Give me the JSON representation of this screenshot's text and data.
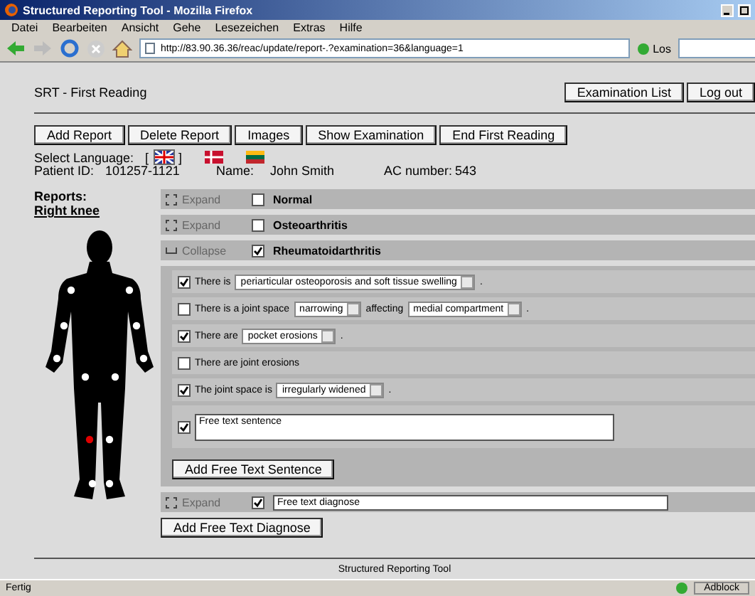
{
  "window": {
    "title": "Structured Reporting Tool - Mozilla Firefox",
    "menu": [
      "Datei",
      "Bearbeiten",
      "Ansicht",
      "Gehe",
      "Lesezeichen",
      "Extras",
      "Hilfe"
    ],
    "url": "http://83.90.36.36/reac/update/report-.?examination=36&language=1",
    "go_button": "Los"
  },
  "page": {
    "heading": "SRT - First Reading",
    "header_buttons": [
      "Examination List",
      "Log out"
    ],
    "actions": [
      "Add Report",
      "Delete Report",
      "Images",
      "Show Examination",
      "End First Reading"
    ],
    "language": {
      "label": "Select Language:",
      "open_mark": "[",
      "close_mark": "]",
      "flags": [
        {
          "kind": "uk",
          "selected": true
        },
        {
          "kind": "dk",
          "selected": false
        },
        {
          "kind": "lt",
          "selected": false
        }
      ]
    },
    "patient": [
      {
        "label": "Patient ID:",
        "value": "101257-1121"
      },
      {
        "label": "Name:",
        "value": "John Smith"
      },
      {
        "label": "AC number:",
        "value": "543"
      }
    ],
    "reports": {
      "label": "Reports:",
      "items": [
        "Right knee"
      ],
      "joints": [
        {
          "selected": false
        },
        {
          "selected": false
        },
        {
          "selected": false
        },
        {
          "selected": false
        },
        {
          "selected": false
        },
        {
          "selected": false
        },
        {
          "selected": false
        },
        {
          "selected": false
        },
        {
          "selected": true
        },
        {
          "selected": false
        },
        {
          "selected": false
        },
        {
          "selected": false
        }
      ]
    },
    "diagnoses": [
      {
        "toggle": "Expand",
        "expanded": false,
        "checked": false,
        "kind": "label",
        "label": "Normal"
      },
      {
        "toggle": "Expand",
        "expanded": false,
        "checked": false,
        "kind": "label",
        "label": "Osteoarthritis"
      },
      {
        "toggle": "Collapse",
        "expanded": true,
        "checked": true,
        "kind": "label",
        "label": "Rheumatoidarthritis",
        "sentences": [
          {
            "checked": true,
            "parts": [
              {
                "kind": "text",
                "text": "There is"
              },
              {
                "kind": "select",
                "value": "periarticular osteoporosis and soft tissue swelling"
              },
              {
                "kind": "text",
                "text": "."
              }
            ]
          },
          {
            "checked": false,
            "parts": [
              {
                "kind": "text",
                "text": "There is a joint space"
              },
              {
                "kind": "select",
                "value": "narrowing"
              },
              {
                "kind": "text",
                "text": "affecting"
              },
              {
                "kind": "select",
                "value": "medial compartment"
              },
              {
                "kind": "text",
                "text": "."
              }
            ]
          },
          {
            "checked": true,
            "parts": [
              {
                "kind": "text",
                "text": "There are"
              },
              {
                "kind": "select",
                "value": "pocket erosions"
              },
              {
                "kind": "text",
                "text": "."
              }
            ]
          },
          {
            "checked": false,
            "parts": [
              {
                "kind": "text",
                "text": "There are joint erosions"
              }
            ]
          },
          {
            "checked": true,
            "parts": [
              {
                "kind": "text",
                "text": "The joint space is"
              },
              {
                "kind": "select",
                "value": "irregularly widened"
              },
              {
                "kind": "text",
                "text": "."
              }
            ]
          },
          {
            "checked": true,
            "parts": [
              {
                "kind": "textarea",
                "value": "Free text sentence"
              }
            ]
          }
        ],
        "add_sentence_button": "Add Free Text Sentence"
      },
      {
        "toggle": "Expand",
        "expanded": false,
        "checked": true,
        "kind": "field",
        "value": "Free text diagnose"
      }
    ],
    "add_diagnose_button": "Add Free Text Diagnose",
    "footer": "Structured Reporting Tool"
  },
  "status_bar": {
    "text": "Fertig",
    "addon": "Adblock"
  }
}
